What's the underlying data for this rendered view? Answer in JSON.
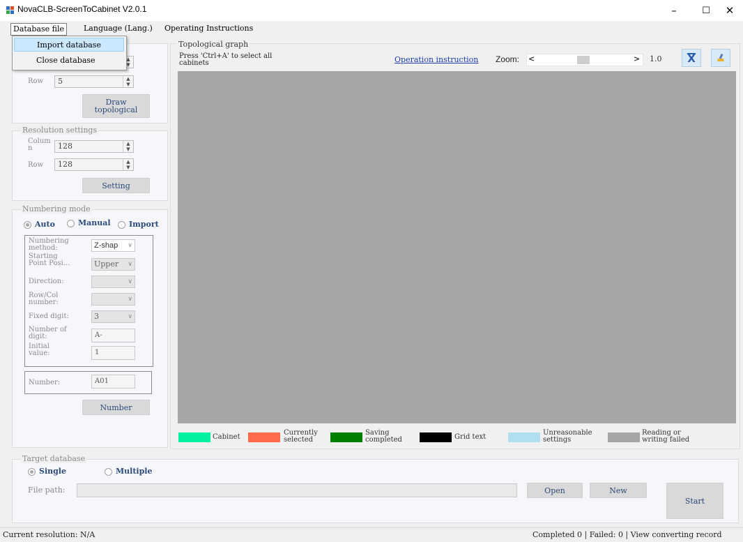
{
  "window": {
    "title": "NovaCLB-ScreenToCabinet V2.0.1",
    "minimize": "–",
    "maximize": "☐",
    "close": "✕"
  },
  "menu": {
    "database_file": "Database file",
    "language": "Language (Lang.)",
    "operating_instructions": "Operating Instructions",
    "dropdown": {
      "import": "Import database",
      "close": "Close database"
    }
  },
  "cabinet": {
    "row_label": "Row",
    "row_value": "5",
    "draw_button": "Draw\ntopological"
  },
  "resolution": {
    "group_label": "Resolution settings",
    "column_label": "Colum\nn",
    "column_value": "128",
    "row_label": "Row",
    "row_value": "128",
    "setting_button": "Setting"
  },
  "numbering": {
    "group_label": "Numbering mode",
    "modes": {
      "auto": "Auto",
      "manual": "Manual",
      "import": "Import"
    },
    "method_label": "Numbering\nmethod:",
    "method_value": "Z-shap",
    "start_label": "Starting\nPoint Posi...",
    "start_value": "Upper",
    "direction_label": "Direction:",
    "rowcol_label": "Row/Col\nnumber:",
    "fixed_label": "Fixed digit:",
    "fixed_value": "3",
    "numdigit_label": "Number of\ndigit:",
    "numdigit_value": "A-",
    "initial_label": "Initial\nvalue:",
    "initial_value": "1",
    "number_label": "Number:",
    "number_value": "A01",
    "number_button": "Number"
  },
  "topological": {
    "group_label": "Topological graph",
    "hint": "Press 'Ctrl+A' to select all\ncabinets",
    "operation_link": "Operation instruction",
    "zoom_label": "Zoom:",
    "zoom_value": "1.0",
    "zoom_left": "<",
    "zoom_right": ">"
  },
  "legend": [
    {
      "label": "Cabinet",
      "color": "#00f0a0"
    },
    {
      "label": "Currently\nselected",
      "color": "#ff6a4a"
    },
    {
      "label": "Saving\ncompleted",
      "color": "#008000"
    },
    {
      "label": "Grid text",
      "color": "#000000"
    },
    {
      "label": "Unreasonable\nsettings",
      "color": "#b0e0f0"
    },
    {
      "label": "Reading or\nwriting failed",
      "color": "#a6a6a6"
    }
  ],
  "target": {
    "group_label": "Target database",
    "single": "Single",
    "multiple": "Multiple",
    "file_path_label": "File path:",
    "open_button": "Open",
    "new_button": "New",
    "start_button": "Start"
  },
  "status": {
    "resolution": "Current resolution: N/A",
    "summary": "Completed 0 | Failed: 0 | View converting record"
  },
  "icons": {
    "app": "app-icon",
    "clear": "excel-clear-icon",
    "brush": "brush-icon"
  }
}
